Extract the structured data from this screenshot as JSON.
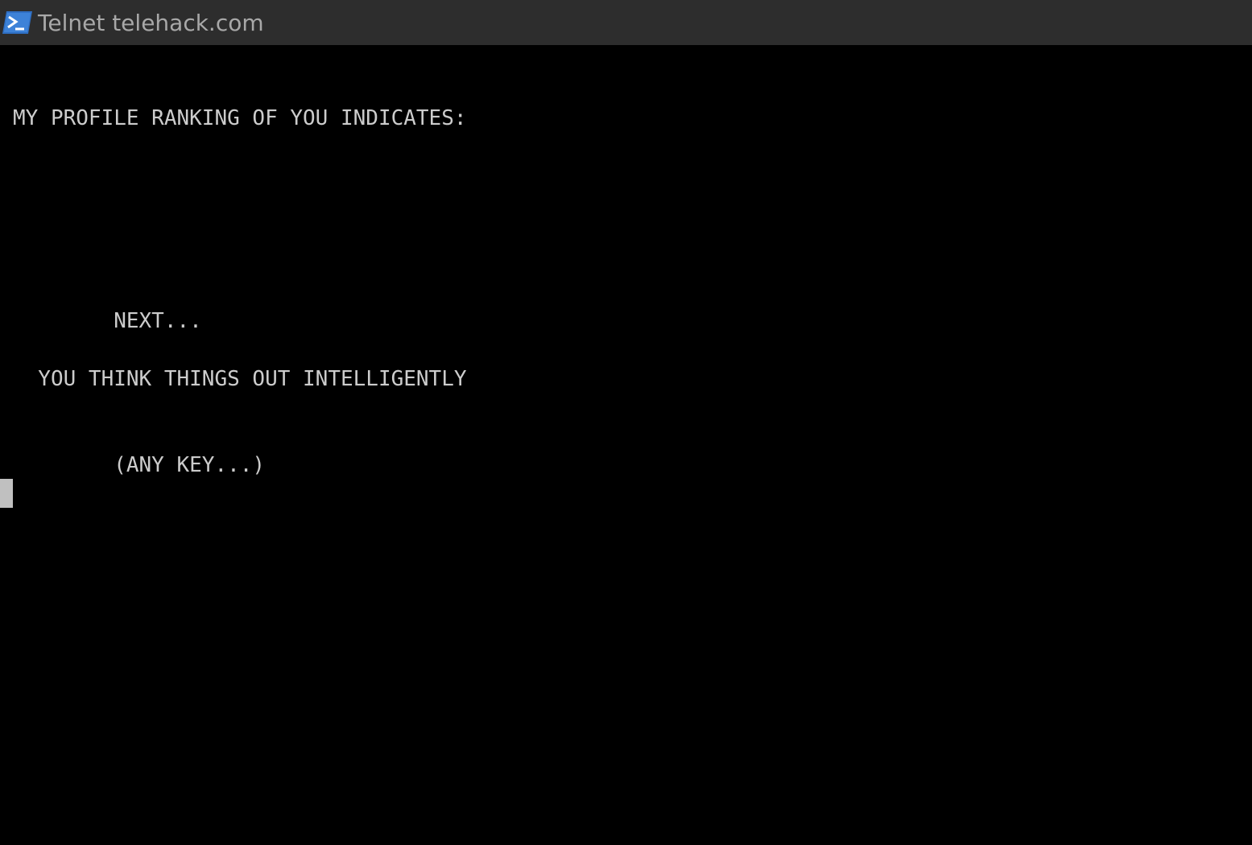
{
  "window": {
    "title": "Telnet telehack.com",
    "icon": "powershell-prompt-icon"
  },
  "terminal": {
    "lines": [
      "MY PROFILE RANKING OF YOU INDICATES:",
      "        NEXT...",
      "  YOU THINK THINGS OUT INTELLIGENTLY",
      "        (ANY KEY...)"
    ]
  },
  "colors": {
    "titlebar_bg": "#2d2d2d",
    "terminal_bg": "#000000",
    "terminal_fg": "#cccccc",
    "cursor": "#c0c0c0",
    "icon_blue": "#2f6fc4"
  }
}
